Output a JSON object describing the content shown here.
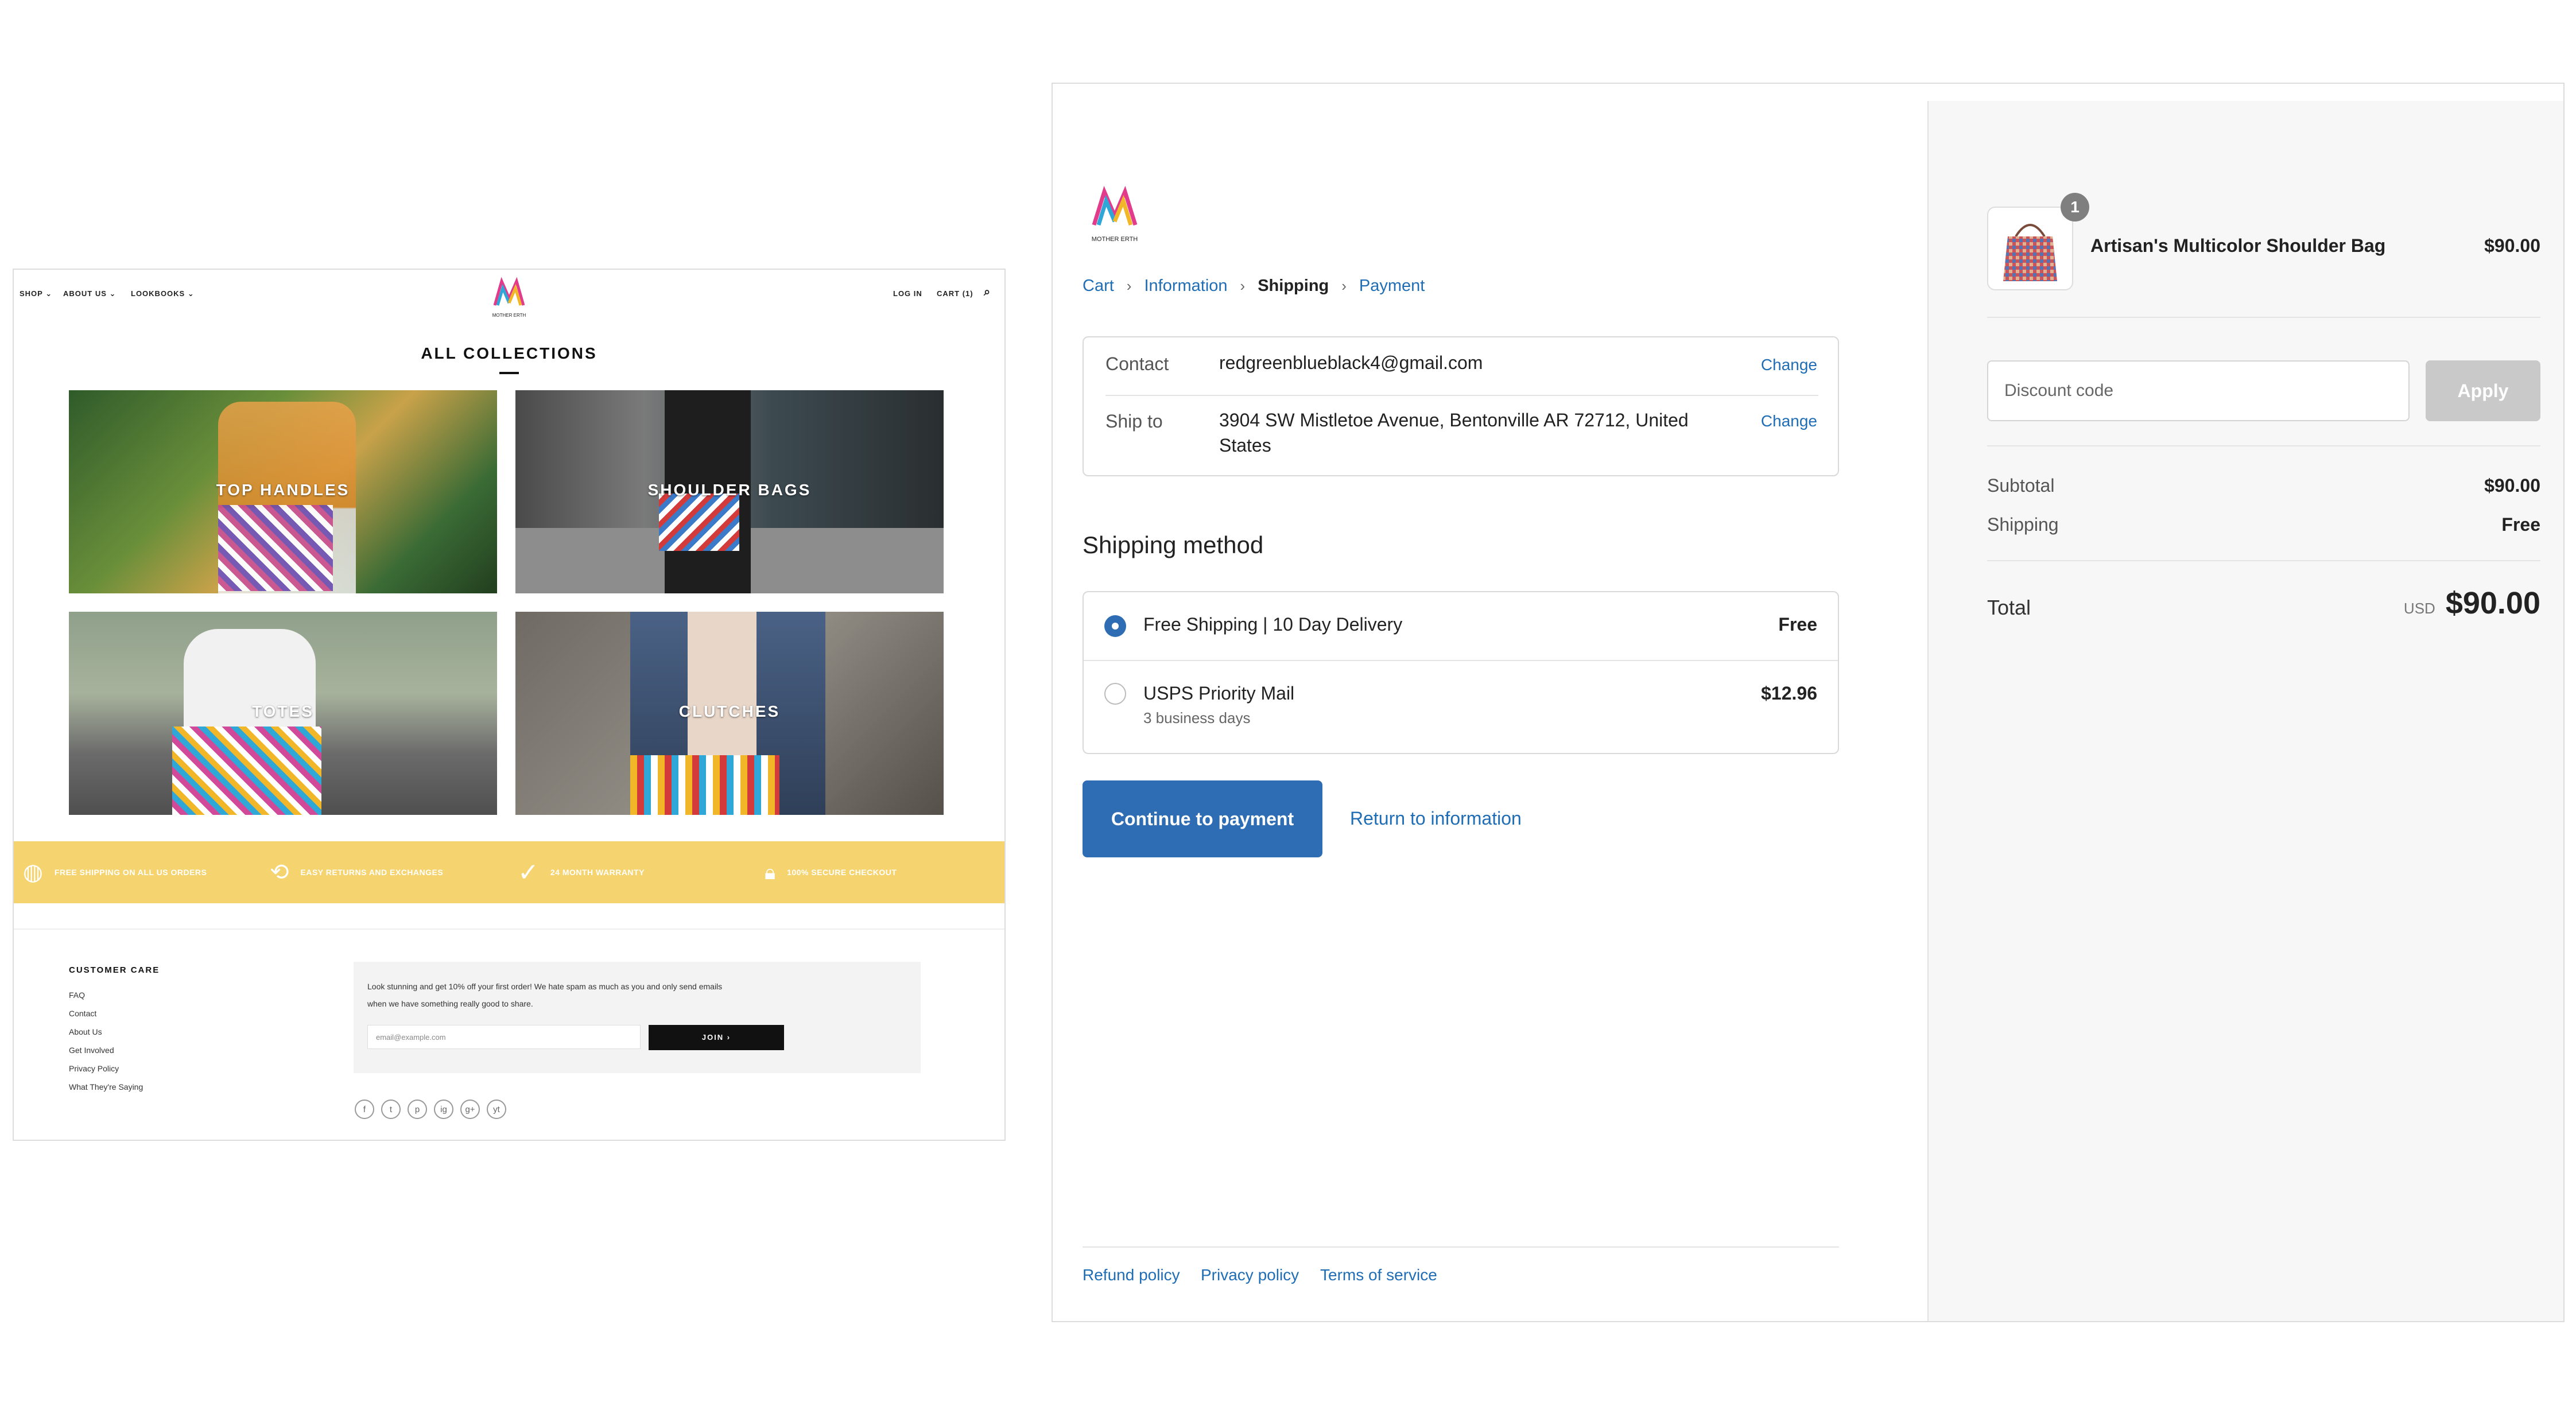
{
  "store": {
    "nav": {
      "shop": "SHOP",
      "about": "ABOUT US",
      "lookbooks": "LOOKBOOKS",
      "login": "LOG IN",
      "cart": "CART (1)"
    },
    "logo_text": "MOTHER ERTH",
    "collections_title": "ALL COLLECTIONS",
    "tiles": [
      {
        "label": "TOP HANDLES"
      },
      {
        "label": "SHOULDER BAGS"
      },
      {
        "label": "TOTES"
      },
      {
        "label": "CLUTCHES"
      }
    ],
    "features": [
      {
        "text": "FREE SHIPPING ON ALL US ORDERS",
        "icon": "globe-icon"
      },
      {
        "text": "EASY RETURNS AND EXCHANGES",
        "icon": "returns-icon"
      },
      {
        "text": "24 MONTH WARRANTY",
        "icon": "check-icon"
      },
      {
        "text": "100% SECURE CHECKOUT",
        "icon": "lock-icon"
      }
    ],
    "footer": {
      "heading": "CUSTOMER CARE",
      "links": [
        "FAQ",
        "Contact",
        "About Us",
        "Get Involved",
        "Privacy Policy",
        "What They're Saying"
      ],
      "newsletter_text": "Look stunning and get 10% off your first order! We hate spam as much as you and only send emails when we have something really good to share.",
      "email_placeholder": "email@example.com",
      "join_label": "JOIN ›",
      "social": [
        "f",
        "t",
        "p",
        "ig",
        "g+",
        "yt"
      ]
    },
    "colors": {
      "banner": "#f5d36e"
    }
  },
  "checkout": {
    "logo_text": "MOTHER ERTH",
    "breadcrumbs": [
      {
        "label": "Cart",
        "current": false
      },
      {
        "label": "Information",
        "current": false
      },
      {
        "label": "Shipping",
        "current": true
      },
      {
        "label": "Payment",
        "current": false
      }
    ],
    "contact": {
      "label": "Contact",
      "value": "redgreenblueblack4@gmail.com",
      "change": "Change"
    },
    "ship_to": {
      "label": "Ship to",
      "value": "3904 SW Mistletoe Avenue, Bentonville AR 72712, United States",
      "change": "Change"
    },
    "shipping_method_title": "Shipping method",
    "options": [
      {
        "title": "Free Shipping | 10 Day Delivery",
        "sub": "",
        "price": "Free",
        "selected": true
      },
      {
        "title": "USPS Priority Mail",
        "sub": "3 business days",
        "price": "$12.96",
        "selected": false
      }
    ],
    "continue_label": "Continue to payment",
    "return_label": "Return to information",
    "footer_links": [
      "Refund policy",
      "Privacy policy",
      "Terms of service"
    ],
    "colors": {
      "accent": "#2e6db4",
      "link": "#1f6db5"
    }
  },
  "summary": {
    "item": {
      "quantity": "1",
      "name": "Artisan's Multicolor Shoulder Bag",
      "price": "$90.00"
    },
    "discount_placeholder": "Discount code",
    "apply_label": "Apply",
    "subtotal_label": "Subtotal",
    "subtotal_value": "$90.00",
    "shipping_label": "Shipping",
    "shipping_value": "Free",
    "total_label": "Total",
    "currency": "USD",
    "total_value": "$90.00"
  }
}
